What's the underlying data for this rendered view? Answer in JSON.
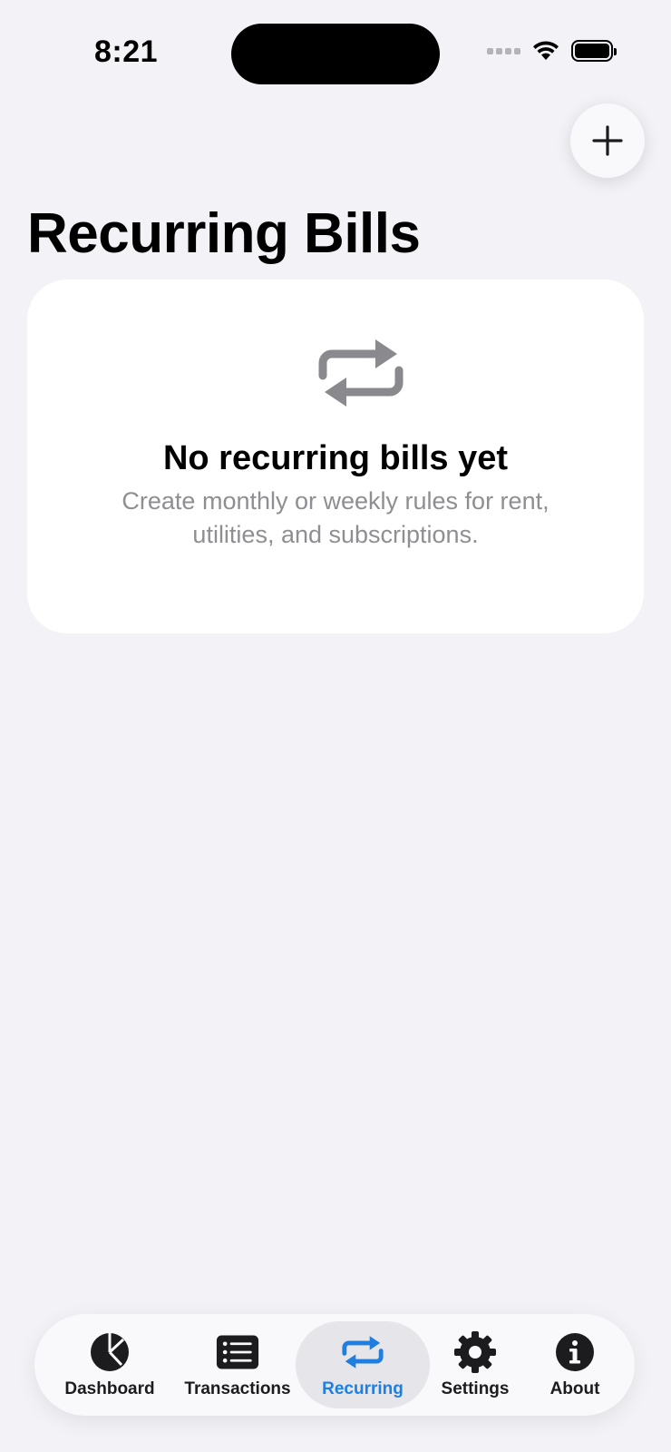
{
  "status_bar": {
    "time": "8:21"
  },
  "header": {
    "title": "Recurring Bills",
    "add_icon": "plus-icon"
  },
  "empty_state": {
    "icon": "repeat-icon",
    "title": "No recurring bills yet",
    "message": "Create monthly or weekly rules for rent, utilities, and subscriptions."
  },
  "tab_bar": {
    "active": "Recurring",
    "accent_color": "#1e7fe0",
    "items": [
      {
        "label": "Dashboard",
        "icon": "pie-chart-icon"
      },
      {
        "label": "Transactions",
        "icon": "list-icon"
      },
      {
        "label": "Recurring",
        "icon": "repeat-icon"
      },
      {
        "label": "Settings",
        "icon": "gear-icon"
      },
      {
        "label": "About",
        "icon": "info-icon"
      }
    ]
  }
}
